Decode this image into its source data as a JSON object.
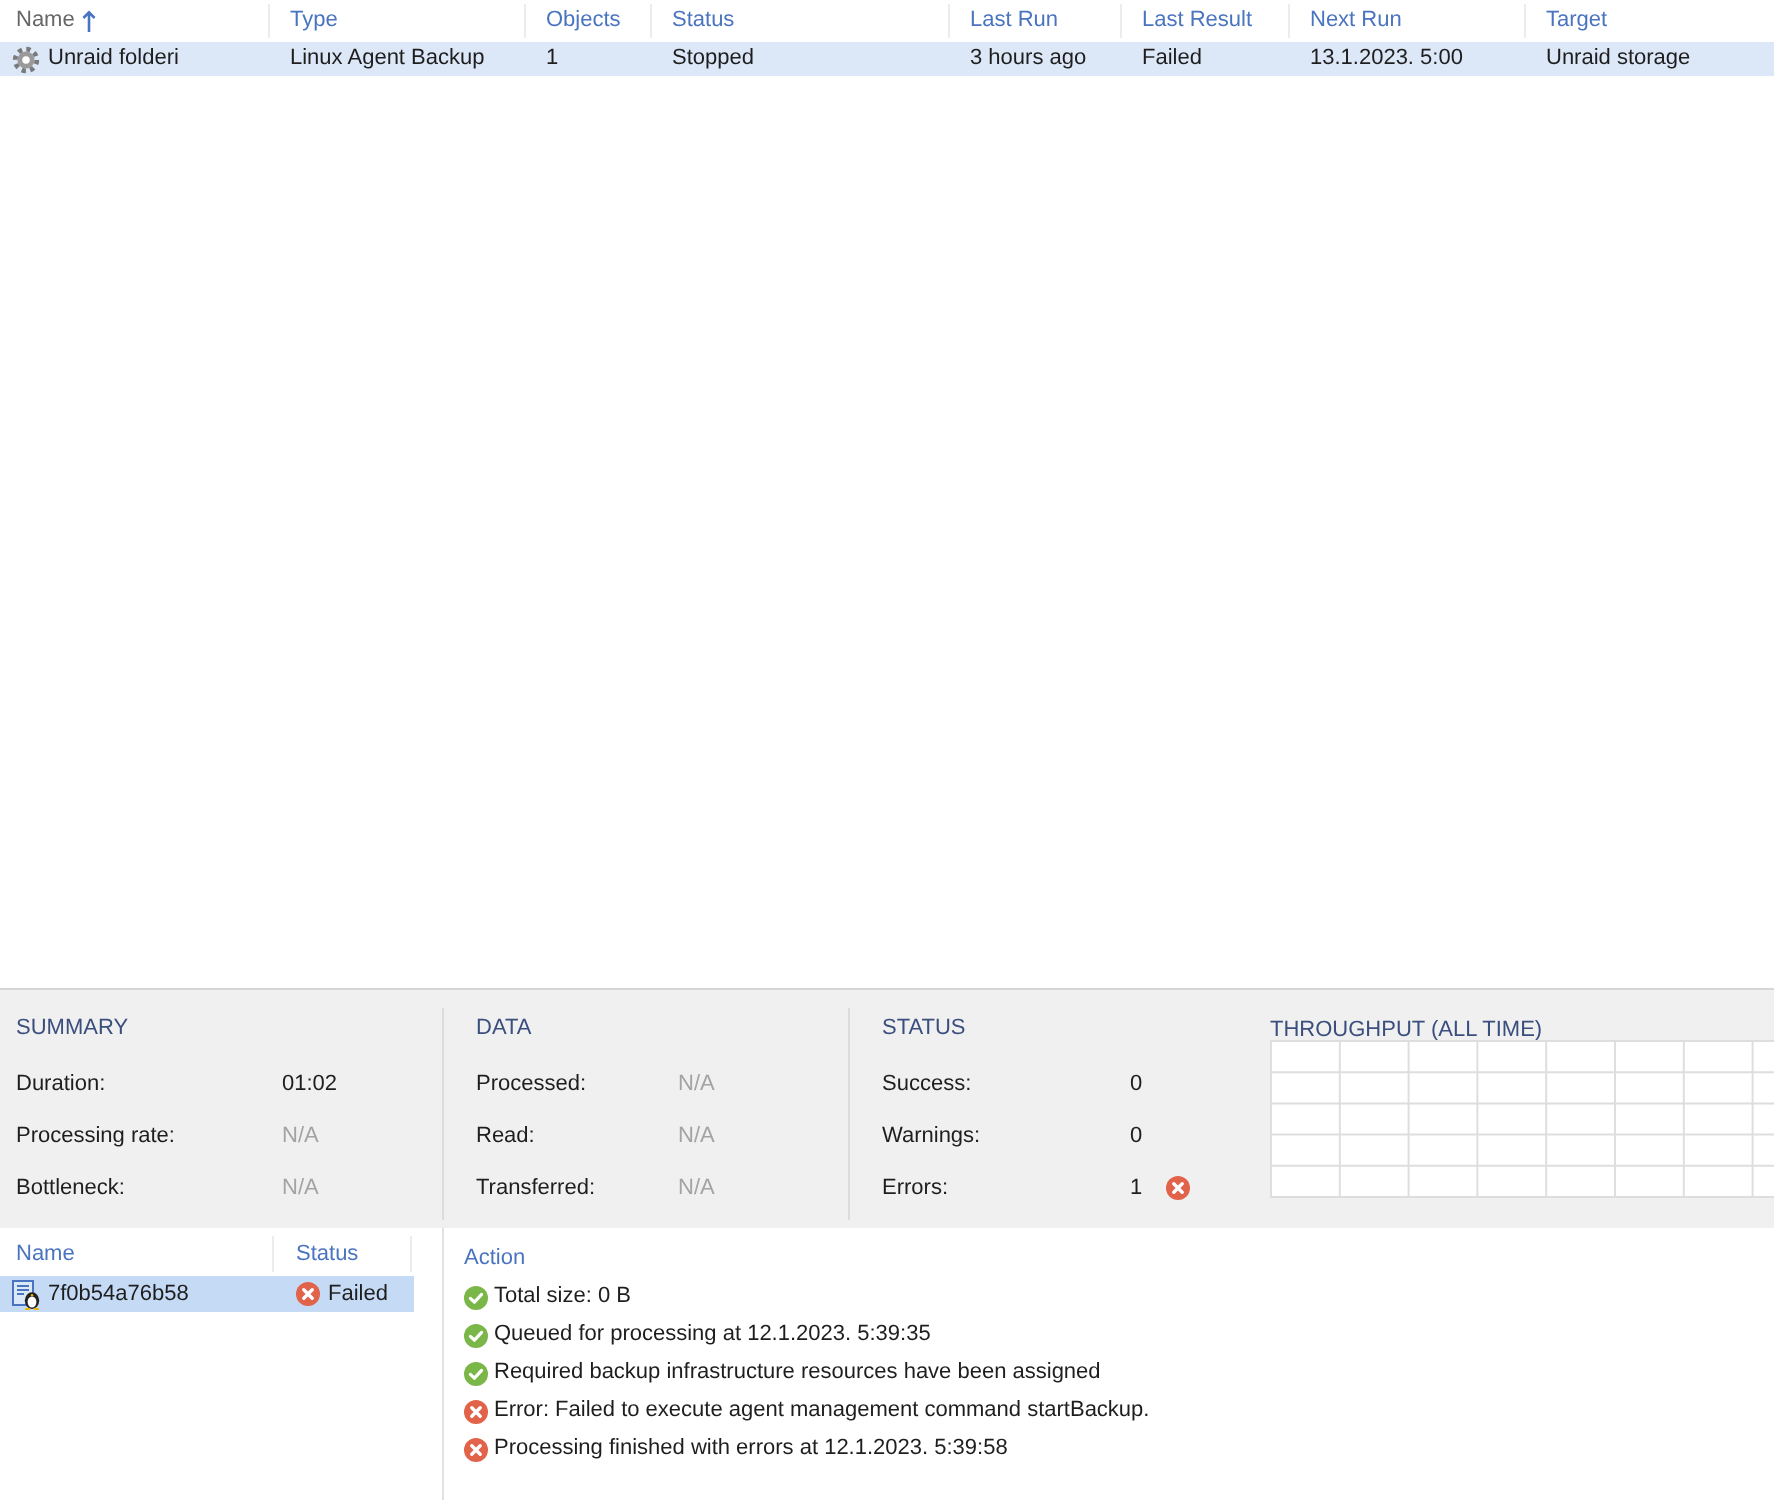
{
  "jobs_table": {
    "columns": [
      {
        "label": "Name",
        "sorted": true
      },
      {
        "label": "Type",
        "sorted": false
      },
      {
        "label": "Objects",
        "sorted": false
      },
      {
        "label": "Status",
        "sorted": false
      },
      {
        "label": "Last Run",
        "sorted": false
      },
      {
        "label": "Last Result",
        "sorted": false
      },
      {
        "label": "Next Run",
        "sorted": false
      },
      {
        "label": "Target",
        "sorted": false
      }
    ],
    "rows": [
      {
        "selected": true,
        "cells": [
          "Unraid folderi",
          "Linux Agent Backup",
          "1",
          "Stopped",
          "3 hours ago",
          "Failed",
          "13.1.2023. 5:00",
          "Unraid storage"
        ]
      }
    ]
  },
  "summary": {
    "sections": [
      {
        "title": "SUMMARY",
        "rows": [
          {
            "label": "Duration:",
            "value": "01:02",
            "muted": false
          },
          {
            "label": "Processing rate:",
            "value": "N/A",
            "muted": true
          },
          {
            "label": "Bottleneck:",
            "value": "N/A",
            "muted": true
          }
        ]
      },
      {
        "title": "DATA",
        "rows": [
          {
            "label": "Processed:",
            "value": "N/A",
            "muted": true
          },
          {
            "label": "Read:",
            "value": "N/A",
            "muted": true
          },
          {
            "label": "Transferred:",
            "value": "N/A",
            "muted": true
          }
        ]
      },
      {
        "title": "STATUS",
        "rows": [
          {
            "label": "Success:",
            "value": "0",
            "muted": false,
            "kind": "count"
          },
          {
            "label": "Warnings:",
            "value": "0",
            "muted": false,
            "kind": "count"
          },
          {
            "label": "Errors:",
            "value": "1",
            "muted": false,
            "kind": "error"
          }
        ]
      }
    ],
    "throughput": {
      "title": "THROUGHPUT (ALL TIME)"
    }
  },
  "tasks": {
    "columns": [
      "Name",
      "Status"
    ],
    "rows": [
      {
        "selected": true,
        "name": "7f0b54a76b58",
        "status": "Failed",
        "kind": "error"
      }
    ]
  },
  "log": {
    "header": "Action",
    "entries": [
      {
        "kind": "success",
        "text": "Total size: 0 B"
      },
      {
        "kind": "success",
        "text": "Queued for processing at 12.1.2023. 5:39:35"
      },
      {
        "kind": "success",
        "text": "Required backup infrastructure resources have been assigned"
      },
      {
        "kind": "error",
        "text": "Error: Failed to execute agent management command startBackup."
      },
      {
        "kind": "error",
        "text": "Processing finished with errors at 12.1.2023. 5:39:58"
      }
    ]
  }
}
